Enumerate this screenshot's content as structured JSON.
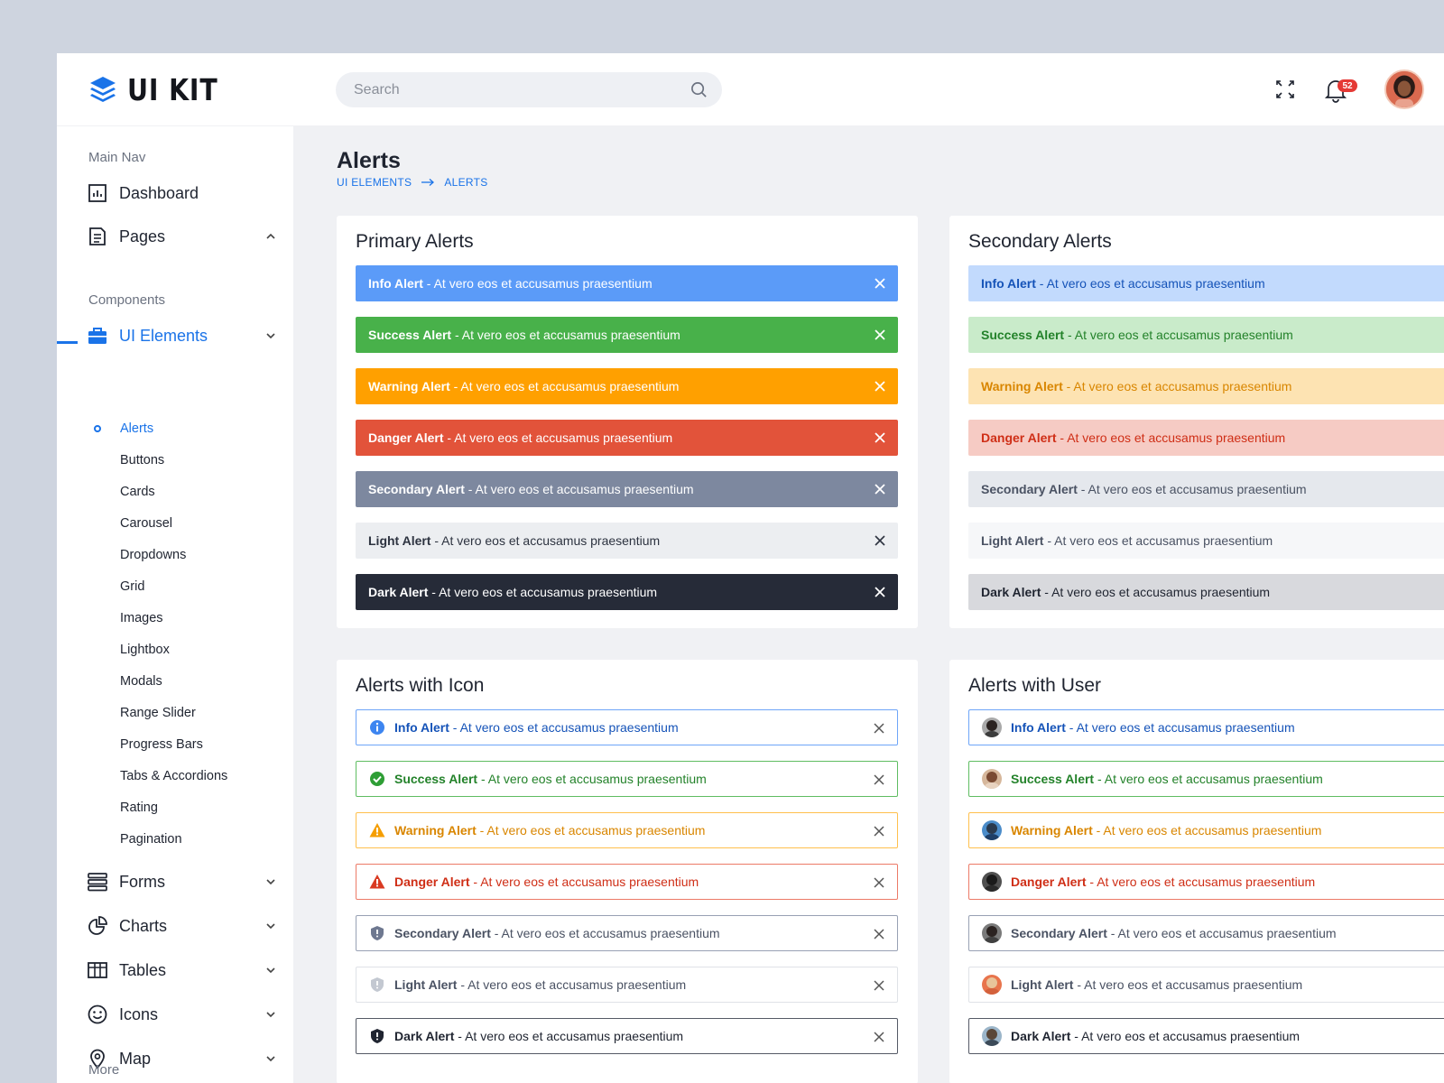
{
  "brand": {
    "name": "UI KIT",
    "accent": "#1a73e8"
  },
  "sidebar": {
    "main_nav_label": "Main Nav",
    "components_label": "Components",
    "more_label": "More",
    "items": [
      {
        "label": "Dashboard",
        "icon": "dashboard-icon"
      },
      {
        "label": "Pages",
        "icon": "pages-icon"
      },
      {
        "label": "UI Elements",
        "icon": "briefcase-icon"
      },
      {
        "label": "Forms",
        "icon": "forms-icon"
      },
      {
        "label": "Charts",
        "icon": "pie-chart-icon"
      },
      {
        "label": "Tables",
        "icon": "table-icon"
      },
      {
        "label": "Icons",
        "icon": "smiley-icon"
      },
      {
        "label": "Map",
        "icon": "map-pin-icon"
      }
    ],
    "ui_elements": [
      "Alerts",
      "Buttons",
      "Cards",
      "Carousel",
      "Dropdowns",
      "Grid",
      "Images",
      "Lightbox",
      "Modals",
      "Range Slider",
      "Progress Bars",
      "Tabs & Accordions",
      "Rating",
      "Pagination"
    ]
  },
  "topbar": {
    "search_placeholder": "Search",
    "notifications": "52"
  },
  "page": {
    "title": "Alerts",
    "breadcrumb": [
      "UI ELEMENTS",
      "ALERTS"
    ]
  },
  "alert_message": "At vero eos et accusamus praesentium",
  "alert_types": [
    "Info Alert",
    "Success Alert",
    "Warning Alert",
    "Danger Alert",
    "Secondary Alert",
    "Light Alert",
    "Dark Alert"
  ],
  "cards": {
    "primary": "Primary Alerts",
    "secondary": "Secondary Alerts",
    "with_icon": "Alerts with Icon",
    "with_user": "Alerts with User"
  },
  "colors": {
    "info": "#5b9bf8",
    "success": "#48b14a",
    "warning": "#ffa000",
    "danger": "#e2533a",
    "secondary": "#7d889f",
    "light": "#eceef1",
    "dark": "#262b38"
  }
}
